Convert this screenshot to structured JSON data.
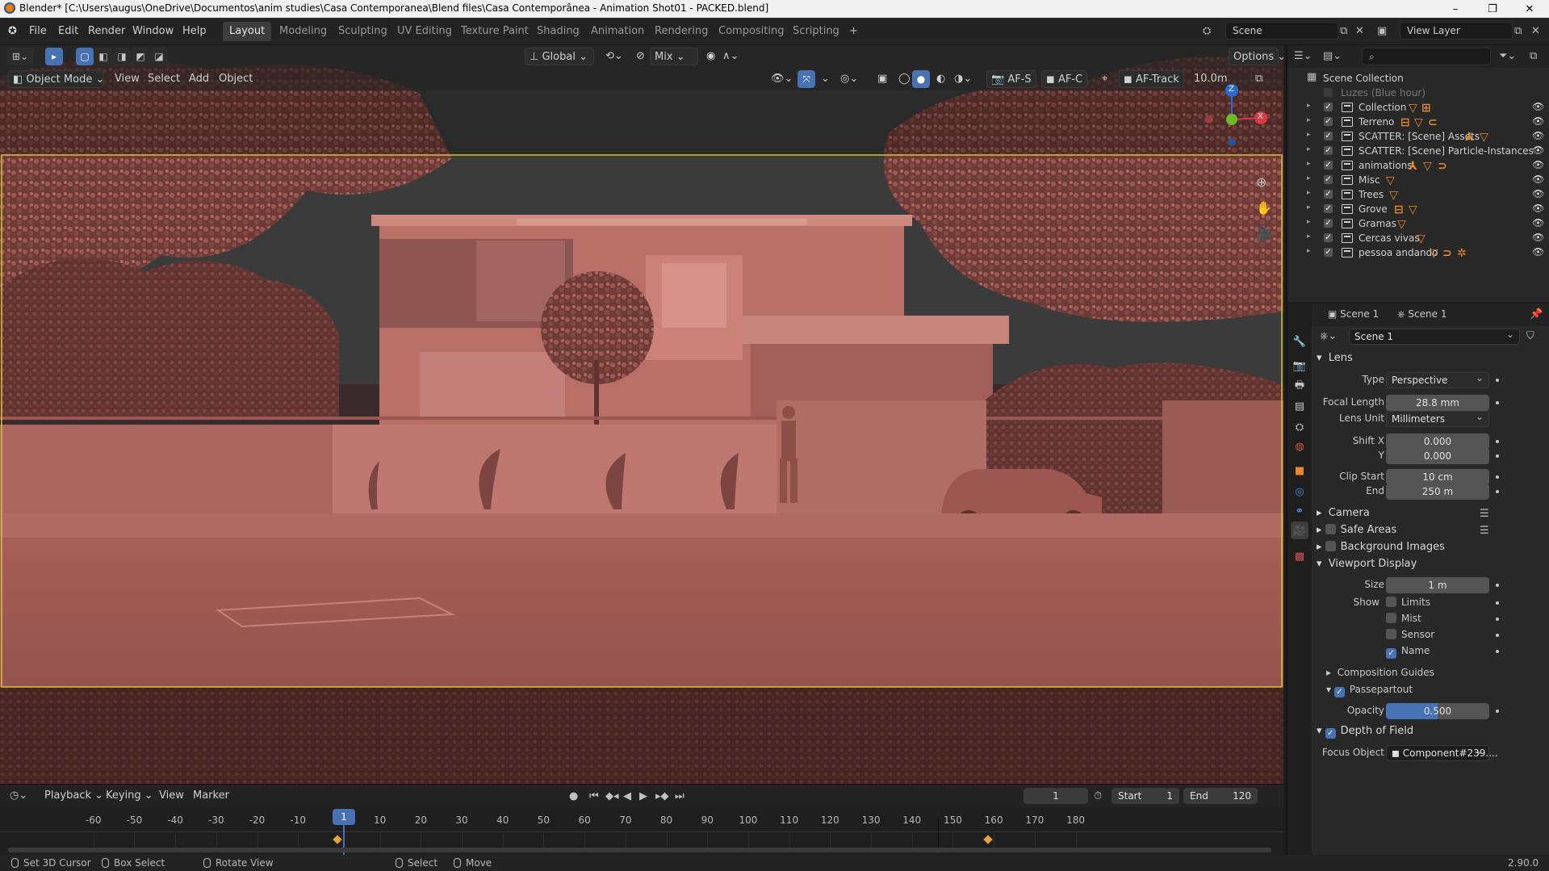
{
  "title_bar": {
    "text": "Blender* [C:\\Users\\augus\\OneDrive\\Documentos\\anim studies\\Casa Contemporanea\\Blend files\\Casa Contemporânea - Animation Shot01 - PACKED.blend]",
    "minimize": "–",
    "maximize": "❐",
    "close": "✕"
  },
  "menu": [
    "File",
    "Edit",
    "Render",
    "Window",
    "Help"
  ],
  "workspaces": [
    "Layout",
    "Modeling",
    "Sculpting",
    "UV Editing",
    "Texture Paint",
    "Shading",
    "Animation",
    "Rendering",
    "Compositing",
    "Scripting"
  ],
  "workspace_add": "+",
  "scene_field": "Scene",
  "view_layer_field": "View Layer",
  "viewport": {
    "mode": "Object Mode",
    "menus": [
      "View",
      "Select",
      "Add",
      "Object"
    ],
    "transform": "Global",
    "snap_mix": "Mix",
    "options": "Options",
    "af_s": "AF-S",
    "af_c": "AF-C",
    "af_track": "AF-Track",
    "distance": "10.0m",
    "gizmo": {
      "z": "Z",
      "x": "X",
      "y": "Y"
    }
  },
  "timeline": {
    "menus": [
      "Playback",
      "Keying",
      "View",
      "Marker"
    ],
    "current_frame": "1",
    "start_label": "Start",
    "start": "1",
    "end_label": "End",
    "end": "120",
    "ruler": [
      "-60",
      "-50",
      "-40",
      "-30",
      "-20",
      "-10",
      "10",
      "20",
      "30",
      "40",
      "50",
      "60",
      "70",
      "80",
      "90",
      "100",
      "110",
      "120",
      "130",
      "140",
      "150",
      "160",
      "170",
      "180"
    ],
    "playhead": "1"
  },
  "status": {
    "items": [
      "Set 3D Cursor",
      "Box Select",
      "Rotate View",
      "Select",
      "Move"
    ],
    "version": "2.90.0"
  },
  "outliner": {
    "root": "Scene Collection",
    "rows": [
      {
        "name": "Luzes (Blue hour)",
        "dim": true
      },
      {
        "name": "Collection"
      },
      {
        "name": "Terreno"
      },
      {
        "name": "SCATTER: [Scene] Assets"
      },
      {
        "name": "SCATTER: [Scene] Particle-Instances"
      },
      {
        "name": "animations"
      },
      {
        "name": "Misc"
      },
      {
        "name": "Trees"
      },
      {
        "name": "Grove"
      },
      {
        "name": "Gramas"
      },
      {
        "name": "Cercas vivas"
      },
      {
        "name": "pessoa andando"
      }
    ]
  },
  "properties": {
    "header_left": "Scene 1",
    "header_right": "Scene 1",
    "datablock": "Scene 1",
    "lens": {
      "title": "Lens",
      "type_label": "Type",
      "type": "Perspective",
      "focal_label": "Focal Length",
      "focal": "28.8 mm",
      "unit_label": "Lens Unit",
      "unit": "Millimeters",
      "shiftx_label": "Shift X",
      "shiftx": "0.000",
      "shifty_label": "Y",
      "shifty": "0.000",
      "clipstart_label": "Clip Start",
      "clipstart": "10 cm",
      "clipend_label": "End",
      "clipend": "250 m"
    },
    "camera": "Camera",
    "safe_areas": "Safe Areas",
    "background_images": "Background Images",
    "viewport_display": {
      "title": "Viewport Display",
      "size_label": "Size",
      "size": "1 m",
      "show_label": "Show",
      "limits": "Limits",
      "mist": "Mist",
      "sensor": "Sensor",
      "name": "Name",
      "composition_guides": "Composition Guides",
      "passepartout": "Passepartout",
      "opacity_label": "Opacity",
      "opacity": "0.500"
    },
    "dof": {
      "title": "Depth of Field",
      "focus_label": "Focus Object",
      "focus": "Component#239...."
    }
  }
}
